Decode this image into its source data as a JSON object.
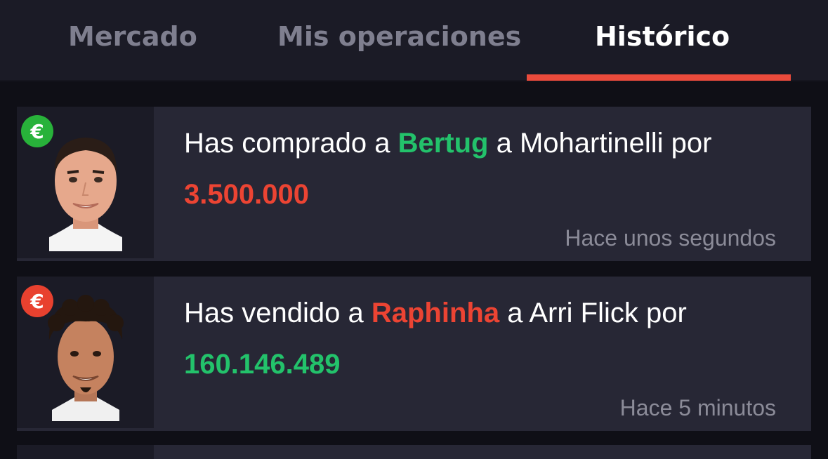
{
  "tabs": {
    "mercado": "Mercado",
    "mis_operaciones": "Mis operaciones",
    "historico": "Histórico"
  },
  "colors": {
    "buy": "#28b23a",
    "sell": "#e8412f",
    "tab_indicator": "#ea4b3c"
  },
  "history": [
    {
      "badge": "€",
      "badge_type": "buy-euro-icon",
      "text_before": "Has comprado a ",
      "player": "Bertug",
      "text_middle": " a Mohartinelli por ",
      "amount": "3.500.000",
      "time": "Hace unos segundos"
    },
    {
      "badge": "€",
      "badge_type": "sell-euro-icon",
      "text_before": "Has vendido a ",
      "player": "Raphinha",
      "text_middle": " a Arri Flick por ",
      "amount": "160.146.489",
      "time": "Hace 5 minutos"
    }
  ]
}
